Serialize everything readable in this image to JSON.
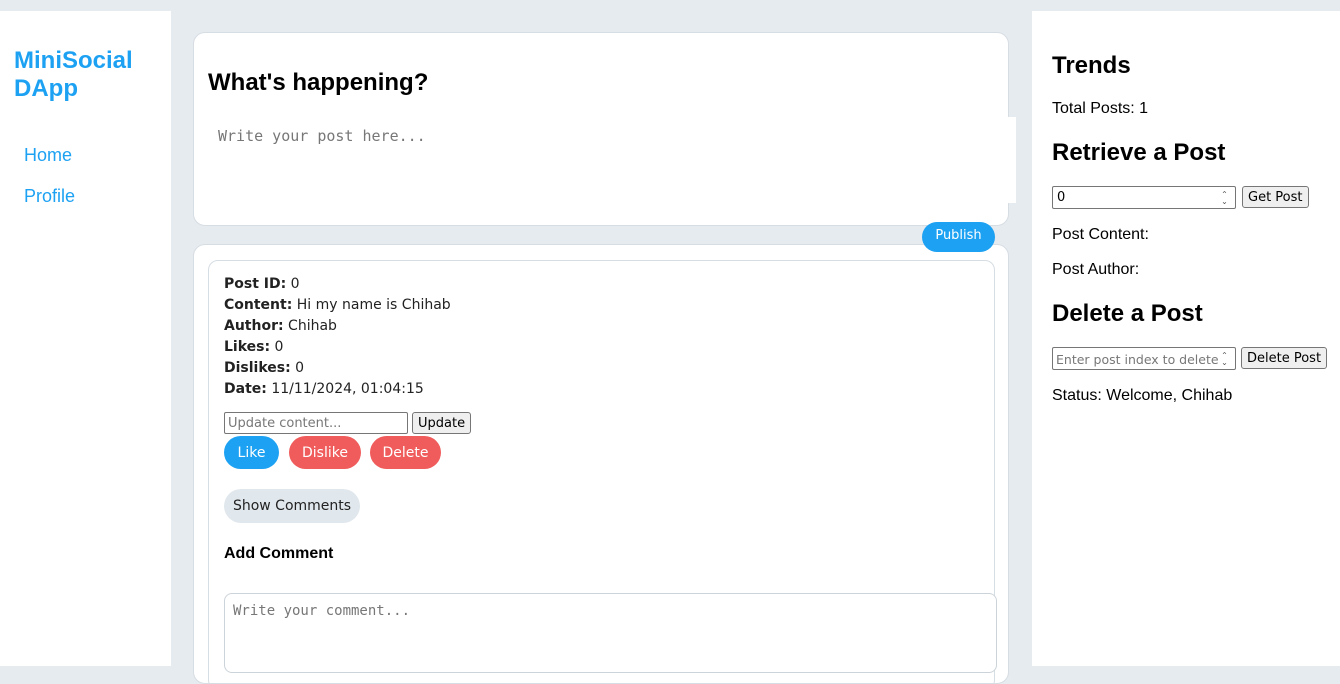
{
  "sidebar": {
    "brand": "MiniSocial DApp",
    "nav": [
      {
        "label": "Home"
      },
      {
        "label": "Profile"
      }
    ]
  },
  "composer": {
    "title": "What's happening?",
    "placeholder": "Write your post here...",
    "publish_label": "Publish"
  },
  "post": {
    "fields": [
      {
        "label": "Post ID:",
        "value": "0"
      },
      {
        "label": "Content:",
        "value": "Hi my name is Chihab"
      },
      {
        "label": "Author:",
        "value": "Chihab"
      },
      {
        "label": "Likes:",
        "value": "0"
      },
      {
        "label": "Dislikes:",
        "value": "0"
      },
      {
        "label": "Date:",
        "value": "11/11/2024, 01:04:15"
      }
    ],
    "update_placeholder": "Update content...",
    "update_label": "Update",
    "like_label": "Like",
    "dislike_label": "Dislike",
    "delete_label": "Delete",
    "show_comments_label": "Show Comments",
    "add_comment_title": "Add Comment",
    "comment_placeholder": "Write your comment..."
  },
  "trends": {
    "title": "Trends",
    "total_posts": "Total Posts: 1",
    "retrieve_title": "Retrieve a Post",
    "retrieve_value": "0",
    "get_post_label": "Get Post",
    "post_content_label": "Post Content:",
    "post_author_label": "Post Author:",
    "delete_title": "Delete a Post",
    "delete_placeholder": "Enter post index to delete",
    "delete_post_label": "Delete Post",
    "status": "Status: Welcome, Chihab"
  },
  "colors": {
    "accent": "#1da1f2",
    "danger": "#f05b5b",
    "background": "#e6ebf0"
  }
}
